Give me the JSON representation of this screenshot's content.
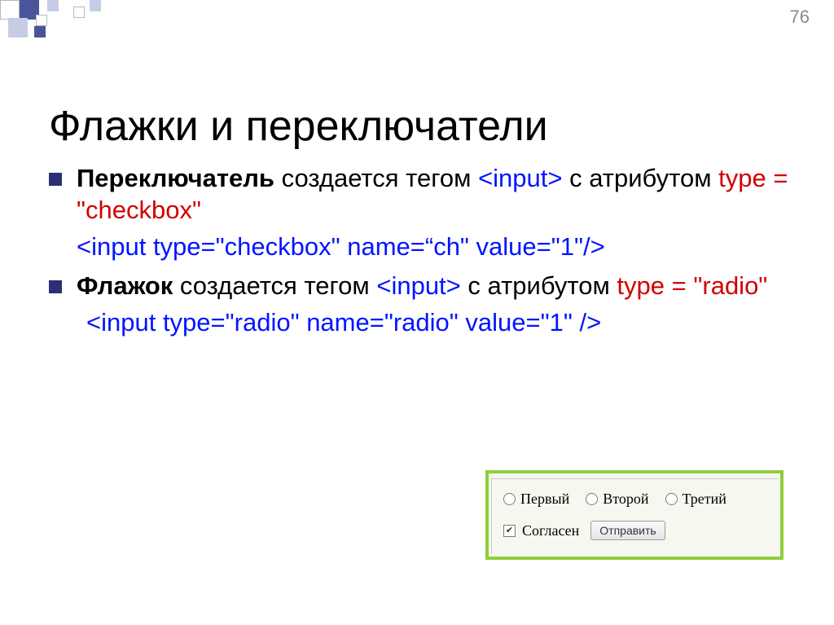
{
  "page_number": "76",
  "title": "Флажки и переключатели",
  "bullets": {
    "b1": {
      "strong": "Переключатель",
      "part1": " создается тегом ",
      "tag": "<input>",
      "part2": " с атрибутом ",
      "attr": "type",
      "eq": " = ",
      "val": "\"checkbox\""
    },
    "code1": "<input type=\"checkbox\" name=“ch\" value=\"1\"/>",
    "b2": {
      "strong": "Флажок",
      "part1": " создается тегом ",
      "tag": "<input>",
      "part2": " с атрибутом ",
      "attr": "type",
      "eq": " = ",
      "val": "\"radio\""
    },
    "code2": "<input type=\"radio\" name=\"radio\" value=\"1\" />"
  },
  "form": {
    "radios": [
      "Первый",
      "Второй",
      "Третий"
    ],
    "checkbox_label": "Согласен",
    "checkbox_checked_glyph": "✔",
    "submit": "Отправить"
  }
}
